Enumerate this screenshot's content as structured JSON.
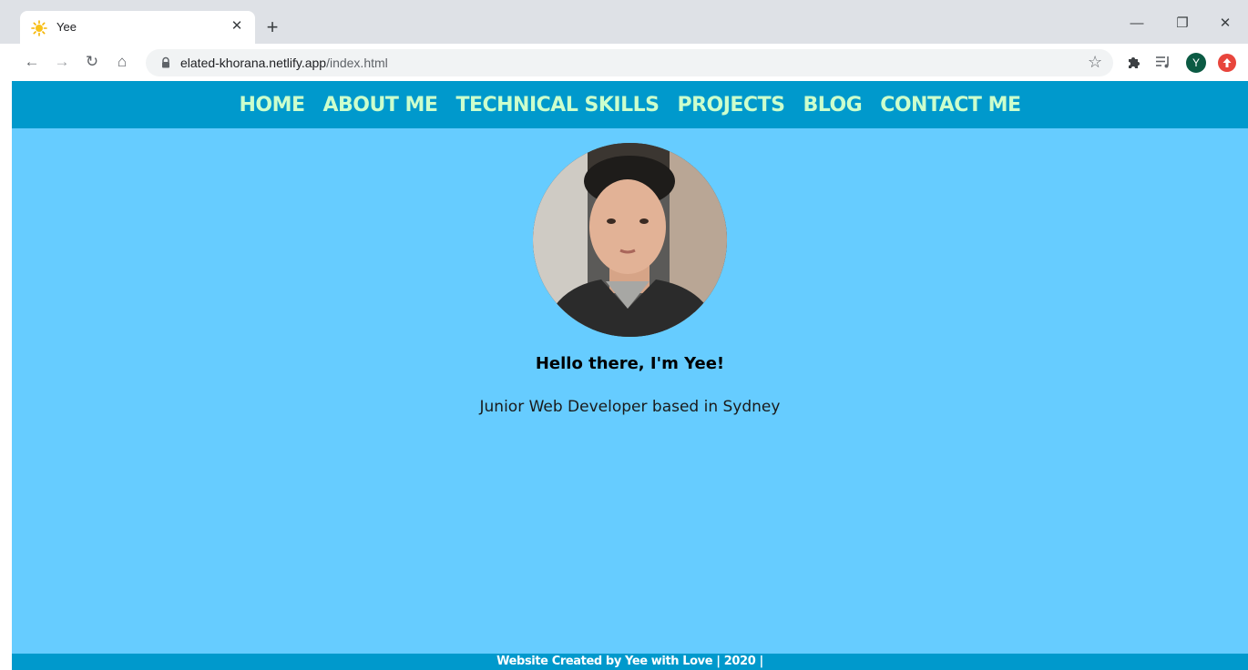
{
  "browser": {
    "tab": {
      "title": "Yee",
      "close_glyph": "✕"
    },
    "new_tab_glyph": "+",
    "window_controls": {
      "minimize": "—",
      "maximize": "❐",
      "close": "✕"
    },
    "nav": {
      "back": "←",
      "forward": "→",
      "reload": "↻",
      "home": "⌂"
    },
    "address": {
      "host": "elated-khorana.netlify.app",
      "path": "/index.html"
    },
    "bookmark_glyph": "☆",
    "extensions": {
      "puzzle": "🧩",
      "media": "≡♪"
    },
    "profile_initial": "Y",
    "icons": [
      "sun-favicon-icon",
      "lock-icon",
      "star-icon",
      "puzzle-icon",
      "media-control-icon",
      "profile-avatar",
      "extension-icon"
    ]
  },
  "site": {
    "nav": [
      "HOME",
      "ABOUT ME",
      "TECHNICAL SKILLS",
      "PROJECTS",
      "BLOG",
      "CONTACT ME"
    ],
    "greeting": "Hello there, I'm Yee!",
    "tagline": "Junior Web Developer based in Sydney",
    "footer": "Website Created by Yee with Love | 2020 |",
    "colors": {
      "nav_bg": "#0099cc",
      "nav_text": "#ccffcc",
      "page_bg": "#66ccff",
      "footer_text": "#ffffff"
    }
  }
}
